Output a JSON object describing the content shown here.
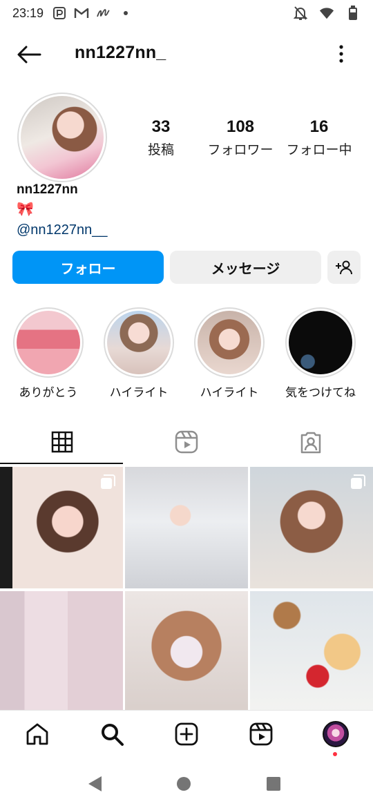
{
  "status_bar": {
    "time": "23:19",
    "left_icons": [
      "p-app-icon",
      "gmail-icon",
      "m-app-icon",
      "dot-icon"
    ],
    "right_icons": [
      "notifications-off-icon",
      "wifi-icon",
      "battery-icon"
    ]
  },
  "header": {
    "username": "nn1227nn_",
    "back_icon": "arrow-left-icon",
    "more_icon": "more-vertical-icon"
  },
  "profile": {
    "stats": {
      "posts": {
        "value": "33",
        "label": "投稿"
      },
      "followers": {
        "value": "108",
        "label": "フォロワー"
      },
      "following": {
        "value": "16",
        "label": "フォロー中"
      }
    },
    "bio": {
      "name": "nn1227nn",
      "emoji": "🎀",
      "link": "@nn1227nn__"
    }
  },
  "actions": {
    "follow_label": "フォロー",
    "message_label": "メッセージ",
    "suggest_icon": "add-person-icon"
  },
  "highlights": [
    {
      "label": "ありがとう"
    },
    {
      "label": "ハイライト"
    },
    {
      "label": "ハイライト"
    },
    {
      "label": "気をつけてね"
    }
  ],
  "tabs": [
    {
      "icon": "grid-icon",
      "selected": true
    },
    {
      "icon": "reels-icon",
      "selected": false
    },
    {
      "icon": "tagged-icon",
      "selected": false
    }
  ],
  "grid_posts": [
    {
      "multi": true
    },
    {
      "multi": false
    },
    {
      "multi": true
    },
    {
      "multi": false
    },
    {
      "multi": false
    },
    {
      "multi": false
    }
  ],
  "bottom_nav": [
    "home-icon",
    "search-icon",
    "create-icon",
    "reels-icon",
    "profile-avatar"
  ],
  "system_nav": [
    "back-triangle-icon",
    "home-circle-icon",
    "recents-square-icon"
  ],
  "colors": {
    "primary_blue": "#0095f6",
    "button_grey": "#efefef",
    "link_blue": "#00376b",
    "notification_red": "#ff3040"
  }
}
